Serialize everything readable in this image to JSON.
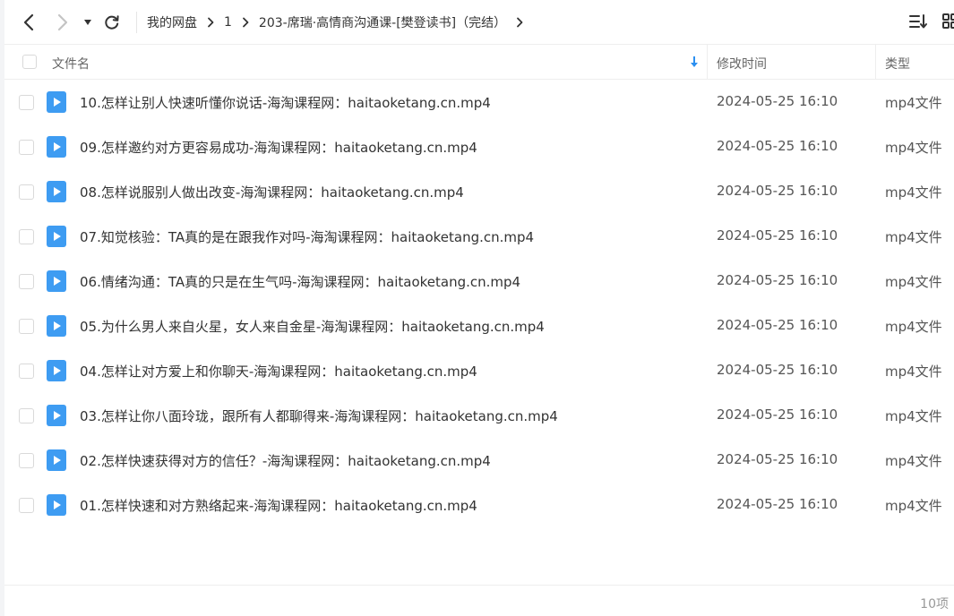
{
  "toolbar": {
    "back_icon": "chevron-left-icon",
    "forward_icon": "chevron-right-icon",
    "history_icon": "caret-down-icon",
    "refresh_icon": "refresh-icon",
    "breadcrumb": [
      "我的网盘",
      "1",
      "203-席瑞·高情商沟通课-[樊登读书]（完结）"
    ],
    "sort_icon": "sort-list-icon",
    "grid_icon": "grid-view-icon"
  },
  "list_header": {
    "name": "文件名",
    "modified": "修改时间",
    "type": "类型",
    "sort_icon": "sort-down-arrow-icon"
  },
  "files": [
    {
      "name": "10.怎样让别人快速听懂你说话-海淘课程网：haitaoketang.cn.mp4",
      "modified": "2024-05-25 16:10",
      "type": "mp4文件"
    },
    {
      "name": "09.怎样邀约对方更容易成功-海淘课程网：haitaoketang.cn.mp4",
      "modified": "2024-05-25 16:10",
      "type": "mp4文件"
    },
    {
      "name": "08.怎样说服别人做出改变-海淘课程网：haitaoketang.cn.mp4",
      "modified": "2024-05-25 16:10",
      "type": "mp4文件"
    },
    {
      "name": "07.知觉核验：TA真的是在跟我作对吗-海淘课程网：haitaoketang.cn.mp4",
      "modified": "2024-05-25 16:10",
      "type": "mp4文件"
    },
    {
      "name": "06.情绪沟通：TA真的只是在生气吗-海淘课程网：haitaoketang.cn.mp4",
      "modified": "2024-05-25 16:10",
      "type": "mp4文件"
    },
    {
      "name": "05.为什么男人来自火星，女人来自金星-海淘课程网：haitaoketang.cn.mp4",
      "modified": "2024-05-25 16:10",
      "type": "mp4文件"
    },
    {
      "name": "04.怎样让对方爱上和你聊天-海淘课程网：haitaoketang.cn.mp4",
      "modified": "2024-05-25 16:10",
      "type": "mp4文件"
    },
    {
      "name": "03.怎样让你八面玲珑，跟所有人都聊得来-海淘课程网：haitaoketang.cn.mp4",
      "modified": "2024-05-25 16:10",
      "type": "mp4文件"
    },
    {
      "name": "02.怎样快速获得对方的信任？-海淘课程网：haitaoketang.cn.mp4",
      "modified": "2024-05-25 16:10",
      "type": "mp4文件"
    },
    {
      "name": "01.怎样快速和对方熟络起来-海淘课程网：haitaoketang.cn.mp4",
      "modified": "2024-05-25 16:10",
      "type": "mp4文件"
    }
  ],
  "file_icon": "video-file-icon",
  "footer": {
    "count": "10项"
  },
  "colors": {
    "video_icon": "#3e9cf2",
    "sort_arrow": "#2b8ff0"
  }
}
